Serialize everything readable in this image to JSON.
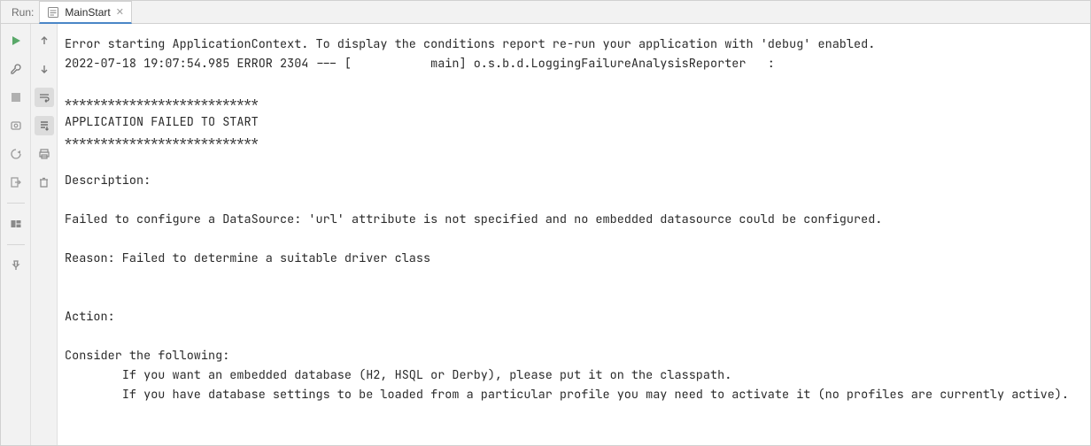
{
  "panel_label": "Run:",
  "tab": {
    "name": "MainStart"
  },
  "console_text": "Error starting ApplicationContext. To display the conditions report re-run your application with 'debug' enabled.\n2022-07-18 19:07:54.985 ERROR 2304 --- [           main] o.s.b.d.LoggingFailureAnalysisReporter   :\n\n***************************\nAPPLICATION FAILED TO START\n***************************\n\nDescription:\n\nFailed to configure a DataSource: 'url' attribute is not specified and no embedded datasource could be configured.\n\nReason: Failed to determine a suitable driver class\n\n\nAction:\n\nConsider the following:\n\tIf you want an embedded database (H2, HSQL or Derby), please put it on the classpath.\n\tIf you have database settings to be loaded from a particular profile you may need to activate it (no profiles are currently active)."
}
